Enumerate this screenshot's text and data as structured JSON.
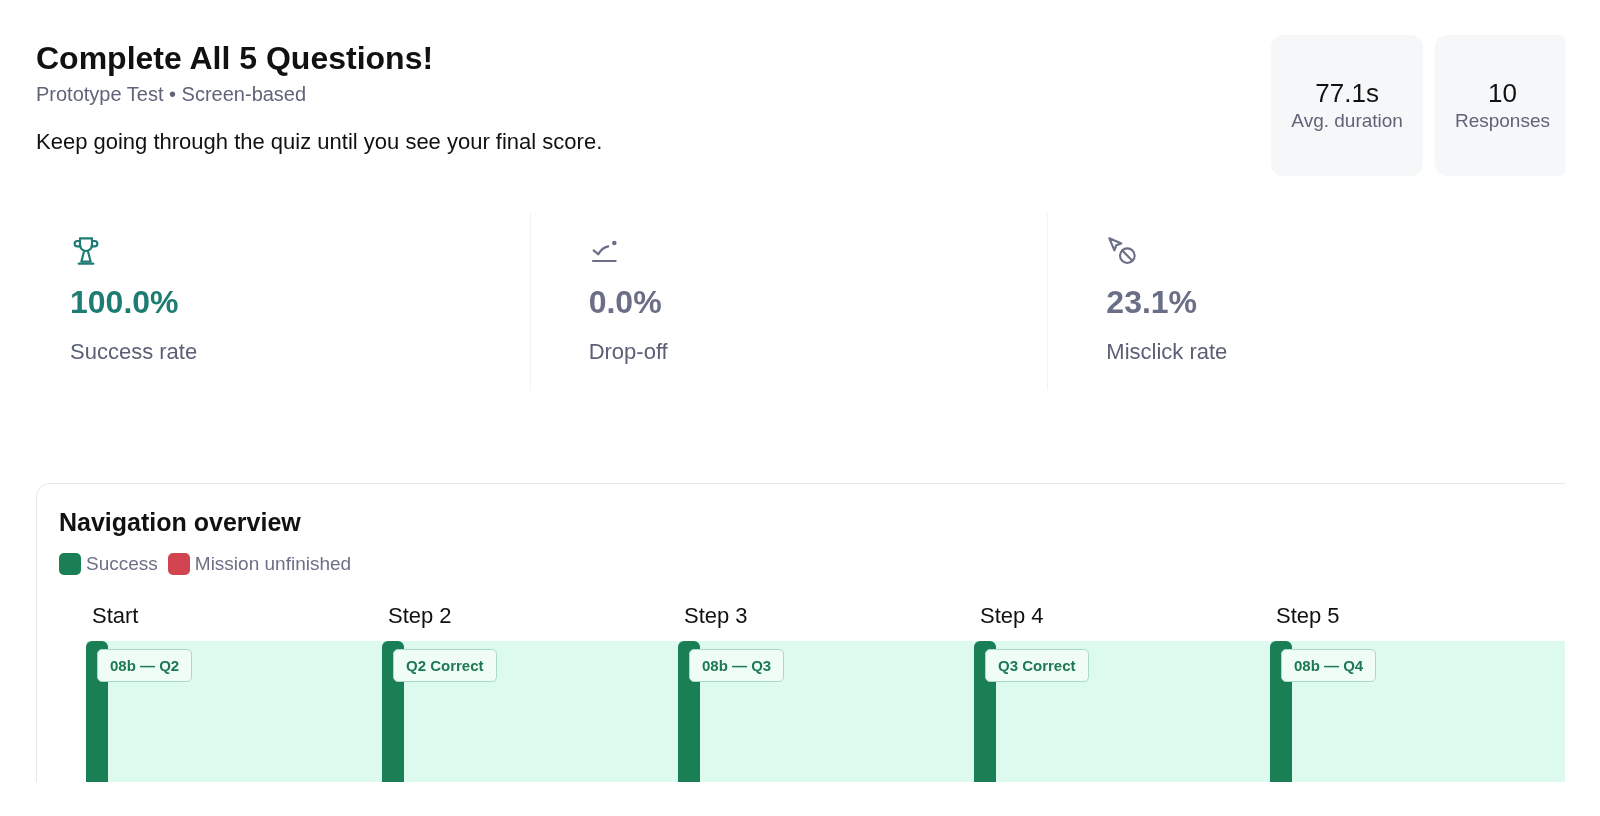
{
  "header": {
    "title": "Complete All 5 Questions!",
    "subtitle": "Prototype Test • Screen-based",
    "description": "Keep going through the quiz until you see your final score."
  },
  "stats": [
    {
      "value": "77.1s",
      "label": "Avg. duration"
    },
    {
      "value": "10",
      "label": "Responses"
    }
  ],
  "metrics": [
    {
      "kind": "success",
      "value": "100.0%",
      "label": "Success rate"
    },
    {
      "kind": "drop_off",
      "value": "0.0%",
      "label": "Drop-off"
    },
    {
      "kind": "misclick",
      "value": "23.1%",
      "label": "Misclick rate"
    }
  ],
  "navigation": {
    "title": "Navigation overview",
    "legend": [
      {
        "label": "Success",
        "color": "#1a7f55"
      },
      {
        "label": "Mission unfinished",
        "color": "#d1434e"
      }
    ],
    "steps": [
      {
        "label": "Start",
        "kind": "success",
        "tag": "08b — Q2"
      },
      {
        "label": "Step 2",
        "kind": "success",
        "tag": "Q2 Correct"
      },
      {
        "label": "Step 3",
        "kind": "success",
        "tag": "08b — Q3"
      },
      {
        "label": "Step 4",
        "kind": "success",
        "tag": "Q3 Correct"
      },
      {
        "label": "Step 5",
        "kind": "success",
        "tag": "08b — Q4"
      }
    ]
  }
}
